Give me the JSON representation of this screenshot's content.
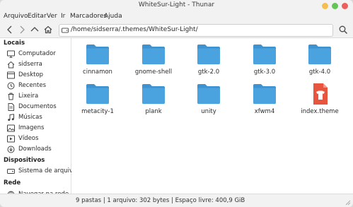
{
  "window": {
    "title": "WhiteSur-Light - Thunar"
  },
  "menu": [
    "Arquivo",
    "Editar",
    "Ver",
    "Ir",
    "Marcadores",
    "Ajuda"
  ],
  "toolbar": {
    "path": "/home/sidserra/.themes/WhiteSur-Light/"
  },
  "sidebar": {
    "locais": "Locais",
    "locais_items": [
      {
        "label": "Computador",
        "icon": "computer-icon"
      },
      {
        "label": "sidserra",
        "icon": "home-icon"
      },
      {
        "label": "Desktop",
        "icon": "desktop-icon"
      },
      {
        "label": "Recentes",
        "icon": "clock-icon"
      },
      {
        "label": "Lixeira",
        "icon": "trash-icon"
      },
      {
        "label": "Documentos",
        "icon": "document-icon"
      },
      {
        "label": "Músicas",
        "icon": "music-icon"
      },
      {
        "label": "Imagens",
        "icon": "image-icon"
      },
      {
        "label": "Vídeos",
        "icon": "video-icon"
      },
      {
        "label": "Downloads",
        "icon": "download-icon"
      }
    ],
    "dispositivos": "Dispositivos",
    "dispositivos_items": [
      {
        "label": "Sistema de arquivos",
        "icon": "drive-icon"
      }
    ],
    "rede": "Rede",
    "rede_items": [
      {
        "label": "Navegar na rede",
        "icon": "network-icon"
      }
    ]
  },
  "files": [
    {
      "name": "cinnamon",
      "type": "folder"
    },
    {
      "name": "gnome-shell",
      "type": "folder"
    },
    {
      "name": "gtk-2.0",
      "type": "folder"
    },
    {
      "name": "gtk-3.0",
      "type": "folder"
    },
    {
      "name": "gtk-4.0",
      "type": "folder"
    },
    {
      "name": "metacity-1",
      "type": "folder"
    },
    {
      "name": "plank",
      "type": "folder"
    },
    {
      "name": "unity",
      "type": "folder"
    },
    {
      "name": "xfwm4",
      "type": "folder"
    },
    {
      "name": "index.theme",
      "type": "theme-file"
    }
  ],
  "status": "9 pastas  |  1 arquivo: 302 bytes  |  Espaço livre: 400,9 GiB",
  "colors": {
    "folder": "#4aa3df",
    "folder_tab": "#3d92cf",
    "close": "#ee5f5b",
    "minimize": "#f5bf4f",
    "maximize": "#62c554",
    "theme_file": "#e8553e"
  }
}
